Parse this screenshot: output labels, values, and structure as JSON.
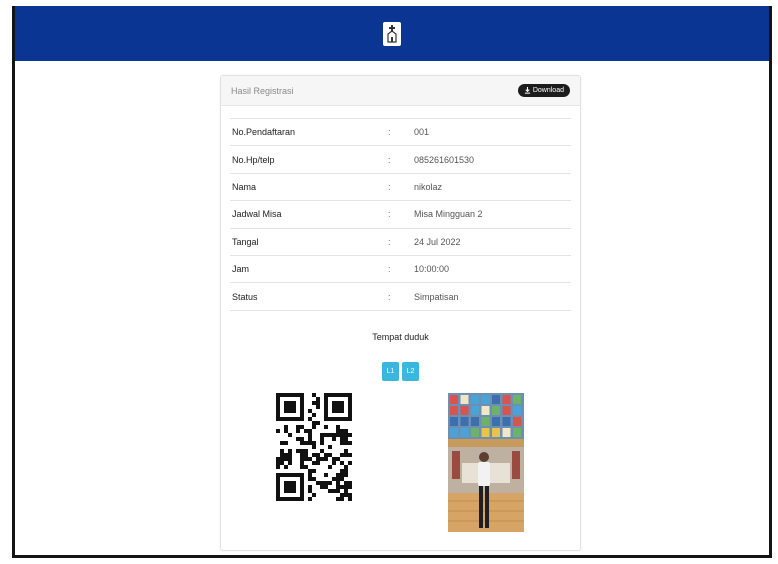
{
  "header": {
    "logo_icon": "church-logo-icon",
    "bar_color": "#0a3592"
  },
  "card": {
    "title": "Hasil Registrasi",
    "download_label": "Download",
    "separator": ":",
    "rows": [
      {
        "label": "No.Pendaftaran",
        "value": "001"
      },
      {
        "label": "No.Hp/telp",
        "value": "085261601530"
      },
      {
        "label": "Nama",
        "value": "nikolaz"
      },
      {
        "label": "Jadwal Misa",
        "value": "Misa Mingguan 2"
      },
      {
        "label": "Tangal",
        "value": "24 Jul 2022"
      },
      {
        "label": "Jam",
        "value": "10:00:00"
      },
      {
        "label": "Status",
        "value": "Simpatisan"
      }
    ],
    "seat_title": "Tempat duduk",
    "seats": [
      "L1",
      "L2"
    ],
    "seat_color": "#3ab7df"
  }
}
